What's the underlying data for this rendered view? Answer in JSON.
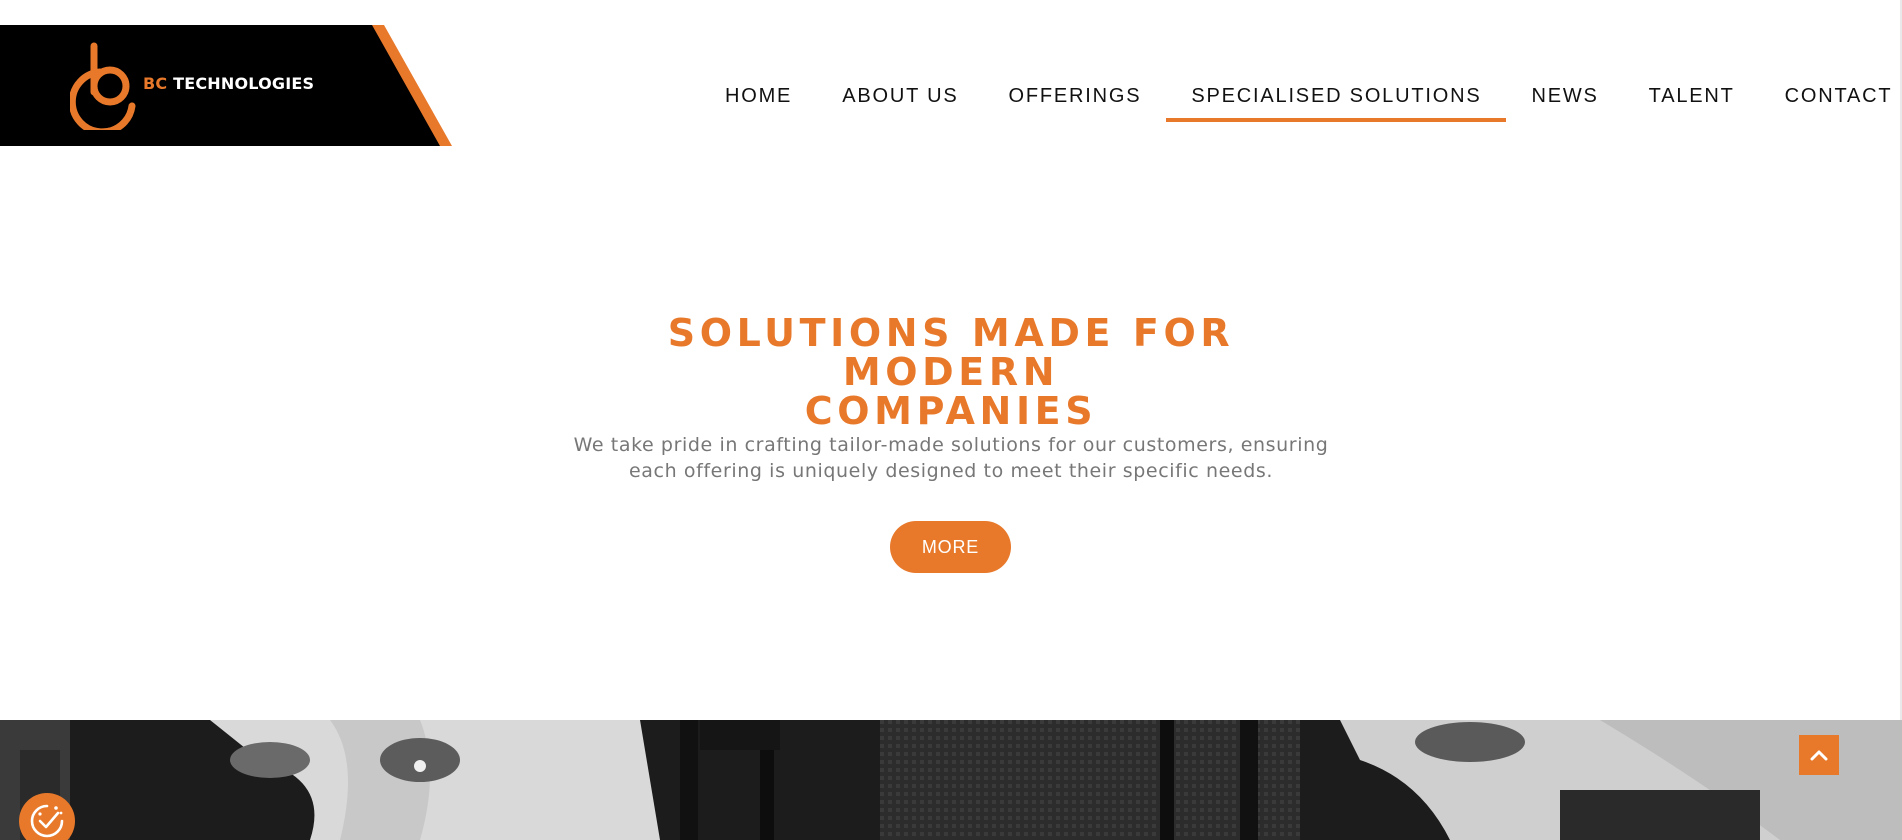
{
  "header": {
    "logo": {
      "icon": "bc-logo-mark",
      "prefix": "BC",
      "name": " TECHNOLOGIES"
    },
    "nav": [
      {
        "label": "HOME",
        "active": false
      },
      {
        "label": "ABOUT US",
        "active": false
      },
      {
        "label": "OFFERINGS",
        "active": false
      },
      {
        "label": "SPECIALISED SOLUTIONS",
        "active": true
      },
      {
        "label": "NEWS",
        "active": false
      },
      {
        "label": "TALENT",
        "active": false
      },
      {
        "label": "CONTACT",
        "active": false
      }
    ]
  },
  "hero": {
    "title_line1": "SOLUTIONS MADE FOR MODERN",
    "title_line2": "COMPANIES",
    "text_line1": "We take pride in crafting tailor-made solutions for our customers, ensuring",
    "text_line2": "each offering is uniquely designed to meet their specific needs.",
    "button": "MORE"
  },
  "widgets": {
    "scroll_top_icon": "chevron-up-icon",
    "cookie_icon": "cookie-consent-icon"
  },
  "colors": {
    "accent": "#e8792b",
    "header_dark": "#000000",
    "text_muted": "#777777"
  }
}
